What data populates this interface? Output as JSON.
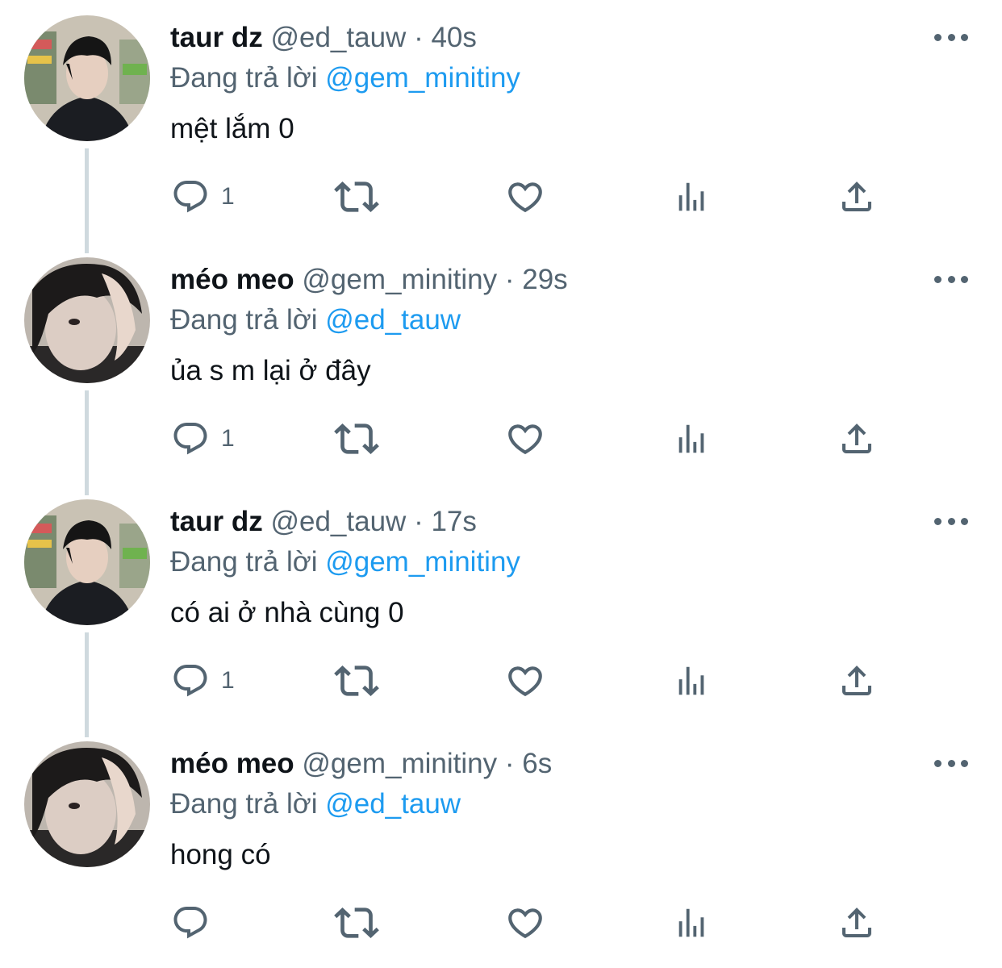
{
  "tweets": [
    {
      "display_name": "taur dz",
      "handle": "@ed_tauw",
      "separator": "·",
      "time": "40s",
      "replying_prefix": "Đang trả lời",
      "replying_to": "@gem_minitiny",
      "text": "mệt lắm 0",
      "reply_count": "1",
      "avatar": "avatar-taur",
      "has_thread_line": true
    },
    {
      "display_name": "méo meo",
      "handle": "@gem_minitiny",
      "separator": "·",
      "time": "29s",
      "replying_prefix": "Đang trả lời",
      "replying_to": "@ed_tauw",
      "text": "ủa s m lại ở đây",
      "reply_count": "1",
      "avatar": "avatar-meo",
      "has_thread_line": true
    },
    {
      "display_name": "taur dz",
      "handle": "@ed_tauw",
      "separator": "·",
      "time": "17s",
      "replying_prefix": "Đang trả lời",
      "replying_to": "@gem_minitiny",
      "text": "có ai ở nhà cùng 0",
      "reply_count": "1",
      "avatar": "avatar-taur",
      "has_thread_line": true
    },
    {
      "display_name": "méo meo",
      "handle": "@gem_minitiny",
      "separator": "·",
      "time": "6s",
      "replying_prefix": "Đang trả lời",
      "replying_to": "@ed_tauw",
      "text": "hong có",
      "reply_count": "",
      "avatar": "avatar-meo",
      "has_thread_line": false
    }
  ],
  "icons": {
    "more": "more-horizontal-icon",
    "reply": "reply-icon",
    "retweet": "retweet-icon",
    "like": "heart-icon",
    "views": "views-icon",
    "share": "share-icon"
  },
  "colors": {
    "text": "#0f1419",
    "secondary": "#536471",
    "mention": "#1d9bf0",
    "thread_line": "#cfd9de"
  }
}
